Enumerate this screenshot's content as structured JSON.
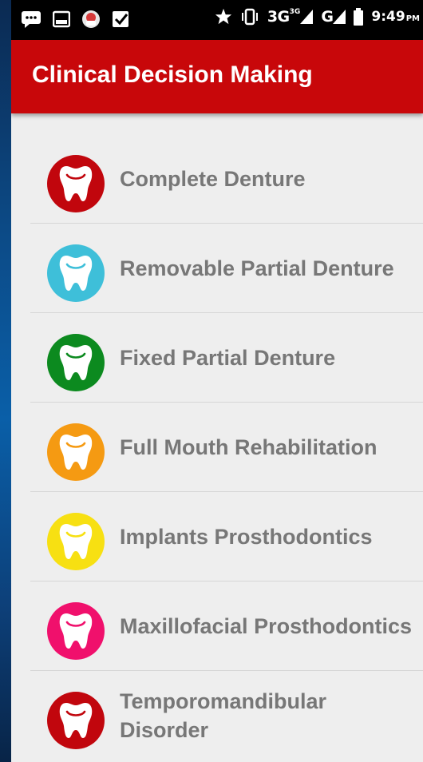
{
  "status_bar": {
    "network_text": "3G",
    "network_sup": "3G",
    "network2_text": "G",
    "time": "9:49",
    "time_suffix": "PM"
  },
  "app_bar": {
    "title": "Clinical Decision Making",
    "color": "#c8070a"
  },
  "menu": {
    "items": [
      {
        "label": "Complete Denture",
        "color": "#c1060d",
        "icon": "tooth-icon"
      },
      {
        "label": "Removable Partial Denture",
        "color": "#3ebfd9",
        "icon": "tooth-icon"
      },
      {
        "label": "Fixed Partial Denture",
        "color": "#0c8a1f",
        "icon": "tooth-icon"
      },
      {
        "label": "Full Mouth Rehabilitation",
        "color": "#f59a12",
        "icon": "tooth-icon"
      },
      {
        "label": "Implants Prosthodontics",
        "color": "#f7e012",
        "icon": "tooth-icon"
      },
      {
        "label": "Maxillofacial Prosthodontics",
        "color": "#f0106c",
        "icon": "tooth-icon"
      },
      {
        "label": "Temporomandibular Disorder",
        "color": "#c1060d",
        "icon": "tooth-icon"
      }
    ]
  }
}
